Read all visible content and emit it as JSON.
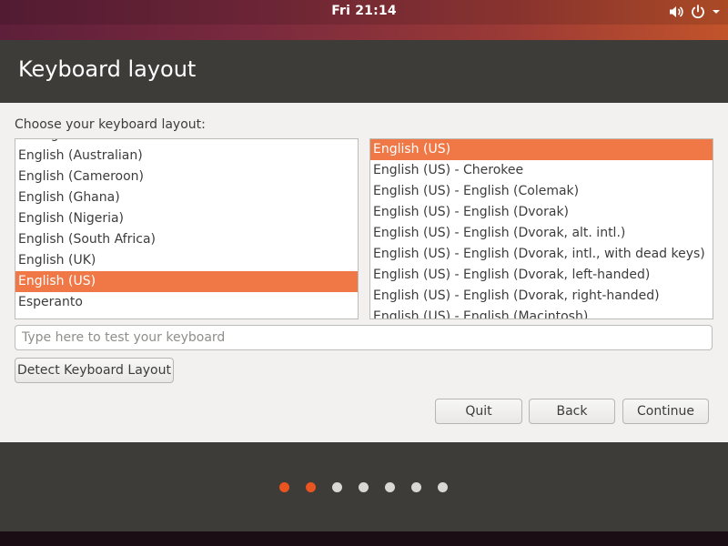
{
  "topbar": {
    "clock": "Fri 21:14",
    "icons": [
      "volume-icon",
      "power-icon",
      "chevron-down-icon"
    ]
  },
  "window": {
    "title": "Keyboard layout",
    "choose_label": "Choose your keyboard layout:",
    "layouts": [
      "Dzongkha",
      "English (Australian)",
      "English (Cameroon)",
      "English (Ghana)",
      "English (Nigeria)",
      "English (South Africa)",
      "English (UK)",
      "English (US)",
      "Esperanto"
    ],
    "selected_layout": "English (US)",
    "variants": [
      "English (US)",
      "English (US) - Cherokee",
      "English (US) - English (Colemak)",
      "English (US) - English (Dvorak)",
      "English (US) - English (Dvorak, alt. intl.)",
      "English (US) - English (Dvorak, intl., with dead keys)",
      "English (US) - English (Dvorak, left-handed)",
      "English (US) - English (Dvorak, right-handed)",
      "English (US) - English (Macintosh)"
    ],
    "selected_variant": "English (US)",
    "test_input": {
      "placeholder": "Type here to test your keyboard",
      "value": ""
    },
    "detect_button": "Detect Keyboard Layout",
    "buttons": {
      "quit": "Quit",
      "back": "Back",
      "continue": "Continue"
    }
  },
  "progress": {
    "total_steps": 7,
    "completed_steps": 2
  },
  "colors": {
    "accent": "#e95420",
    "selection": "#f07746",
    "header": "#3d3c39"
  }
}
